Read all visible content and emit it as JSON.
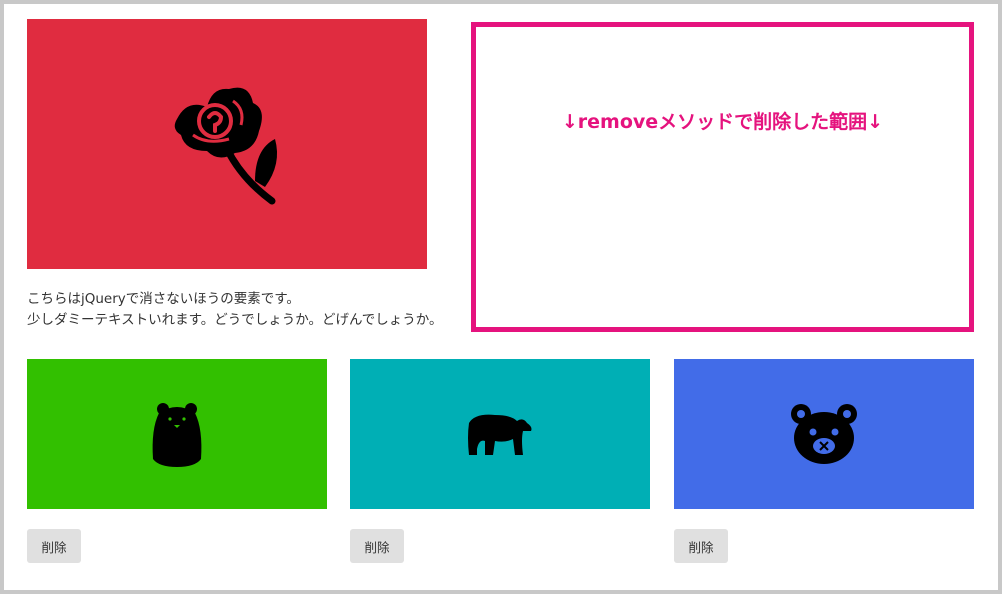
{
  "hero": {
    "color": "#e02c40",
    "icon": "rose-icon",
    "text_line1": "こちらはjQueryで消さないほうの要素です。",
    "text_line2": "少しダミーテキストいれます。どうでしょうか。どげんでしょうか。"
  },
  "removed_area": {
    "label": "↓removeメソッドで削除した範囲↓",
    "color": "#e5137e"
  },
  "cards": [
    {
      "color": "#32c000",
      "icon": "standing-bear-icon",
      "button_label": "削除"
    },
    {
      "color": "#00afb5",
      "icon": "polar-bear-icon",
      "button_label": "削除"
    },
    {
      "color": "#426ce8",
      "icon": "bear-face-icon",
      "button_label": "削除"
    }
  ]
}
